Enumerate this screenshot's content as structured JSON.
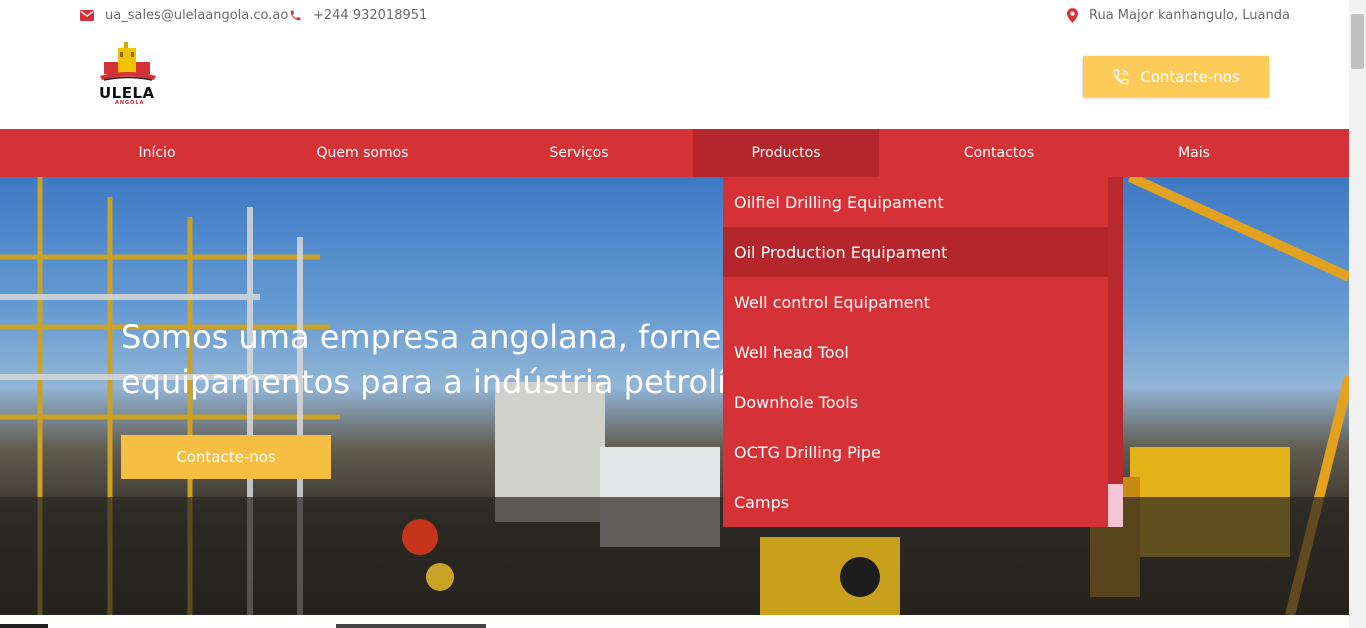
{
  "topbar": {
    "email": "ua_sales@ulelaangola.co.ao",
    "phone": "+244 932018951",
    "address": "Rua Major kanhangulo, Luanda"
  },
  "logo": {
    "name": "ULELA",
    "sub": "ANGOLA"
  },
  "header": {
    "contact_button": "Contacte-nos"
  },
  "nav": {
    "items": [
      "Início",
      "Quem somos",
      "Serviços",
      "Productos",
      "Contactos",
      "Mais"
    ],
    "active": "Productos"
  },
  "hero": {
    "title": "Somos uma empresa angolana, fornecedora de serviços e equipamentos para a indústria petrolífera angolana.",
    "button": "Contacte-nos"
  },
  "dropdown": {
    "items": [
      "Oilfiel Drilling Equipament",
      "Oil Production Equipament",
      "Well control Equipament",
      "Well head Tool",
      "Downhole Tools",
      "OCTG Drilling Pipe",
      "Camps"
    ],
    "highlighted": "Oil Production Equipament"
  },
  "colors": {
    "brand_red": "#d43237",
    "active_red": "#b3272c",
    "button_yellow": "#fccb5a",
    "hero_button_yellow": "#f6be42"
  },
  "icons": [
    "envelope-icon",
    "phone-icon",
    "map-pin-icon",
    "phone-ringing-icon"
  ]
}
